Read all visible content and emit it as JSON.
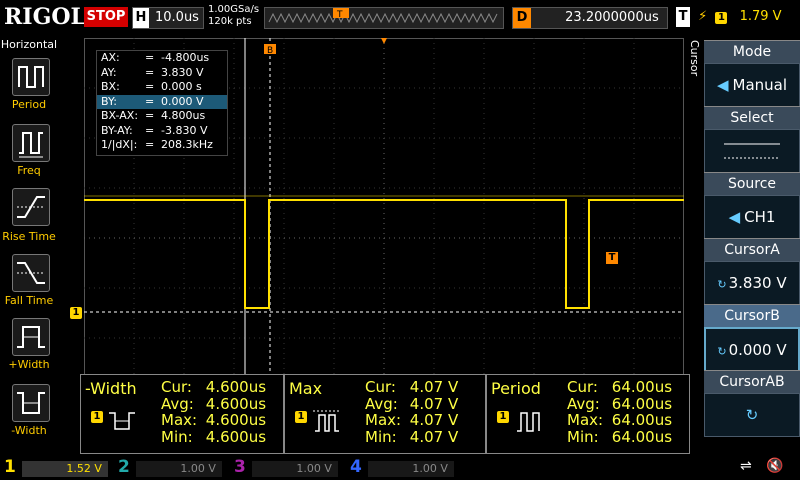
{
  "topbar": {
    "logo": "RIGOL",
    "status": "STOP",
    "timebase_label": "H",
    "timebase_value": "10.0us",
    "sample_rate": "1.00GSa/s",
    "memory_depth": "120k pts",
    "delay_label": "D",
    "delay_value": "23.2000000us",
    "trigger_label": "T",
    "trigger_channel": "1",
    "trigger_level": "1.79 V"
  },
  "left_panel": {
    "title": "Horizontal",
    "items": [
      {
        "label": "Period"
      },
      {
        "label": "Freq"
      },
      {
        "label": "Rise Time"
      },
      {
        "label": "Fall Time"
      },
      {
        "label": "+Width"
      },
      {
        "label": "-Width"
      }
    ]
  },
  "cursor_readout": {
    "rows": [
      {
        "key": "AX:",
        "eq": "=",
        "val": "-4.800us"
      },
      {
        "key": "AY:",
        "eq": "=",
        "val": "3.830 V"
      },
      {
        "key": "BX:",
        "eq": "=",
        "val": "0.000 s"
      },
      {
        "key": "BY:",
        "eq": "=",
        "val": "0.000 V"
      },
      {
        "key": "BX-AX:",
        "eq": "=",
        "val": "4.800us"
      },
      {
        "key": "BY-AY:",
        "eq": "=",
        "val": "-3.830 V"
      },
      {
        "key": "1/|dX|:",
        "eq": "=",
        "val": "208.3kHz"
      }
    ]
  },
  "markers": {
    "cursor_b": "B",
    "channel_ref": "1",
    "trigger_marker": "T"
  },
  "measurements": [
    {
      "title": "-Width",
      "channel": "1",
      "cur": "4.600us",
      "avg": "4.600us",
      "max": "4.600us",
      "min": "4.600us"
    },
    {
      "title": "Max",
      "channel": "1",
      "cur": "4.07 V",
      "avg": "4.07 V",
      "max": "4.07 V",
      "min": "4.07 V"
    },
    {
      "title": "Period",
      "channel": "1",
      "cur": "64.00us",
      "avg": "64.00us",
      "max": "64.00us",
      "min": "64.00us"
    }
  ],
  "meas_labels": {
    "cur": "Cur:",
    "avg": "Avg:",
    "max": "Max:",
    "min": "Min:"
  },
  "right_panel": {
    "vertical_label": "Cursor",
    "mode_title": "Mode",
    "mode_value": "Manual",
    "select_title": "Select",
    "source_title": "Source",
    "source_value": "CH1",
    "cursor_a_title": "CursorA",
    "cursor_a_value": "3.830 V",
    "cursor_b_title": "CursorB",
    "cursor_b_value": "0.000 V",
    "cursor_ab_title": "CursorAB"
  },
  "channels": [
    {
      "num": "1",
      "scale": "1.52 V",
      "color": "#ffe000"
    },
    {
      "num": "2",
      "scale": "1.00 V",
      "color": "#00c0c0"
    },
    {
      "num": "3",
      "scale": "1.00 V",
      "color": "#c000c0"
    },
    {
      "num": "4",
      "scale": "1.00 V",
      "color": "#3070ff"
    }
  ]
}
